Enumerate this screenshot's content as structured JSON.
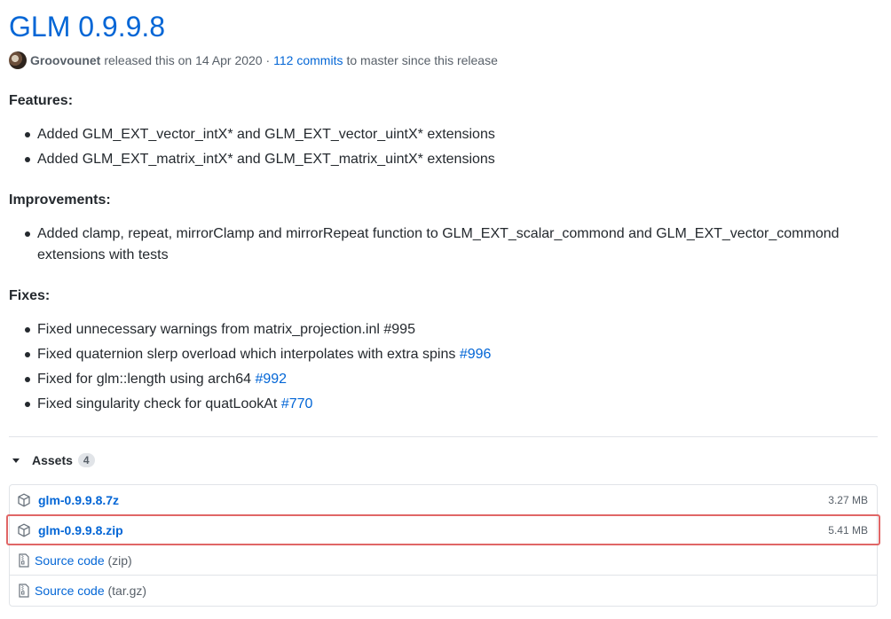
{
  "release": {
    "title": "GLM 0.9.9.8",
    "author": "Groovounet",
    "released_text": "released this on 14 Apr 2020 ·",
    "commits_link": "112 commits",
    "since_text": "to master since this release"
  },
  "sections": {
    "features": {
      "heading": "Features:",
      "items": [
        "Added GLM_EXT_vector_intX* and GLM_EXT_vector_uintX* extensions",
        "Added GLM_EXT_matrix_intX* and GLM_EXT_matrix_uintX* extensions"
      ]
    },
    "improvements": {
      "heading": "Improvements:",
      "items": [
        {
          "line1": "Added clamp, repeat, mirrorClamp and mirrorRepeat function to GLM_EXT_scalar_commond and GLM_EXT_vector_commond",
          "line2": "extensions with tests"
        }
      ]
    },
    "fixes": {
      "heading": "Fixes:",
      "items": [
        {
          "text": "Fixed unnecessary warnings from matrix_projection.inl #995",
          "link": ""
        },
        {
          "text": "Fixed quaternion slerp overload which interpolates with extra spins ",
          "link": "#996"
        },
        {
          "text": "Fixed for glm::length using arch64 ",
          "link": "#992"
        },
        {
          "text": "Fixed singularity check for quatLookAt ",
          "link": "#770"
        }
      ]
    }
  },
  "assets": {
    "label": "Assets",
    "count": "4",
    "items": [
      {
        "name": "glm-0.9.9.8.7z",
        "size": "3.27 MB",
        "icon": "package-icon"
      },
      {
        "name": "glm-0.9.9.8.zip",
        "size": "5.41 MB",
        "icon": "package-icon"
      },
      {
        "name": "Source code",
        "ext": "(zip)",
        "icon": "file-zip-icon"
      },
      {
        "name": "Source code",
        "ext": "(tar.gz)",
        "icon": "file-zip-icon"
      }
    ]
  },
  "colors": {
    "link": "#0366d6",
    "highlight": "#e06666"
  }
}
